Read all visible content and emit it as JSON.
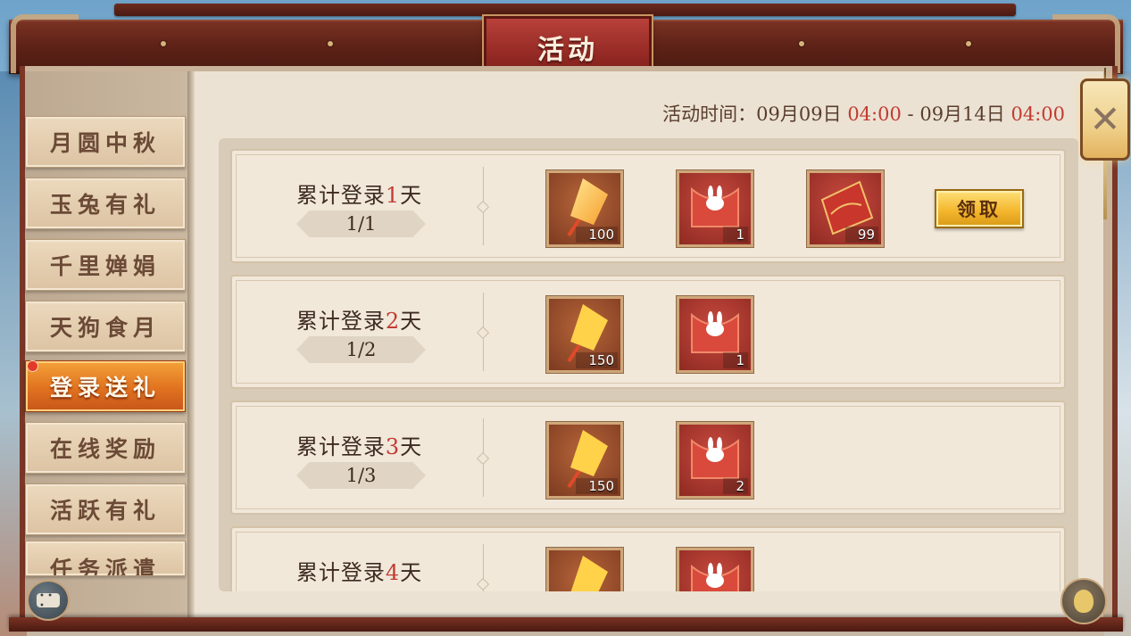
{
  "header": {
    "title": "活动"
  },
  "event_time": {
    "label": "活动时间：",
    "start_date": "09月09日",
    "start_time": "04:00",
    "separator": "-",
    "end_date": "09月14日",
    "end_time": "04:00"
  },
  "sidebar": {
    "items": [
      {
        "label": "月圆中秋",
        "active": false
      },
      {
        "label": "玉兔有礼",
        "active": false
      },
      {
        "label": "千里婵娟",
        "active": false
      },
      {
        "label": "天狗食月",
        "active": false
      },
      {
        "label": "登录送礼",
        "active": true,
        "badge": "red-dot"
      },
      {
        "label": "在线奖励",
        "active": false
      },
      {
        "label": "活跃有礼",
        "active": false
      },
      {
        "label": "任务派遣",
        "active": false
      }
    ]
  },
  "rows": [
    {
      "title_prefix": "累计登录",
      "day": "1",
      "title_suffix": "天",
      "progress": "1/1",
      "rewards": [
        {
          "icon": "sky-lantern-icon",
          "count": "100"
        },
        {
          "icon": "rabbit-red-envelope-icon",
          "count": "1"
        },
        {
          "icon": "red-scroll-icon",
          "count": "99"
        }
      ],
      "claim_label": "领取"
    },
    {
      "title_prefix": "累计登录",
      "day": "2",
      "title_suffix": "天",
      "progress": "1/2",
      "rewards": [
        {
          "icon": "sky-lantern-icon",
          "count": "150"
        },
        {
          "icon": "rabbit-red-envelope-icon",
          "count": "1"
        }
      ]
    },
    {
      "title_prefix": "累计登录",
      "day": "3",
      "title_suffix": "天",
      "progress": "1/3",
      "rewards": [
        {
          "icon": "sky-lantern-icon",
          "count": "150"
        },
        {
          "icon": "rabbit-red-envelope-icon",
          "count": "2"
        }
      ]
    },
    {
      "title_prefix": "累计登录",
      "day": "4",
      "title_suffix": "天",
      "progress": "",
      "rewards": [
        {
          "icon": "sky-lantern-icon",
          "count": ""
        },
        {
          "icon": "rabbit-red-envelope-icon",
          "count": ""
        }
      ]
    }
  ],
  "close_icon": "close-icon",
  "colors": {
    "accent_red": "#c23b32",
    "active_tab": "#e0721f",
    "claim_button": "#f4b72e",
    "frame_wood": "#5e2217"
  }
}
